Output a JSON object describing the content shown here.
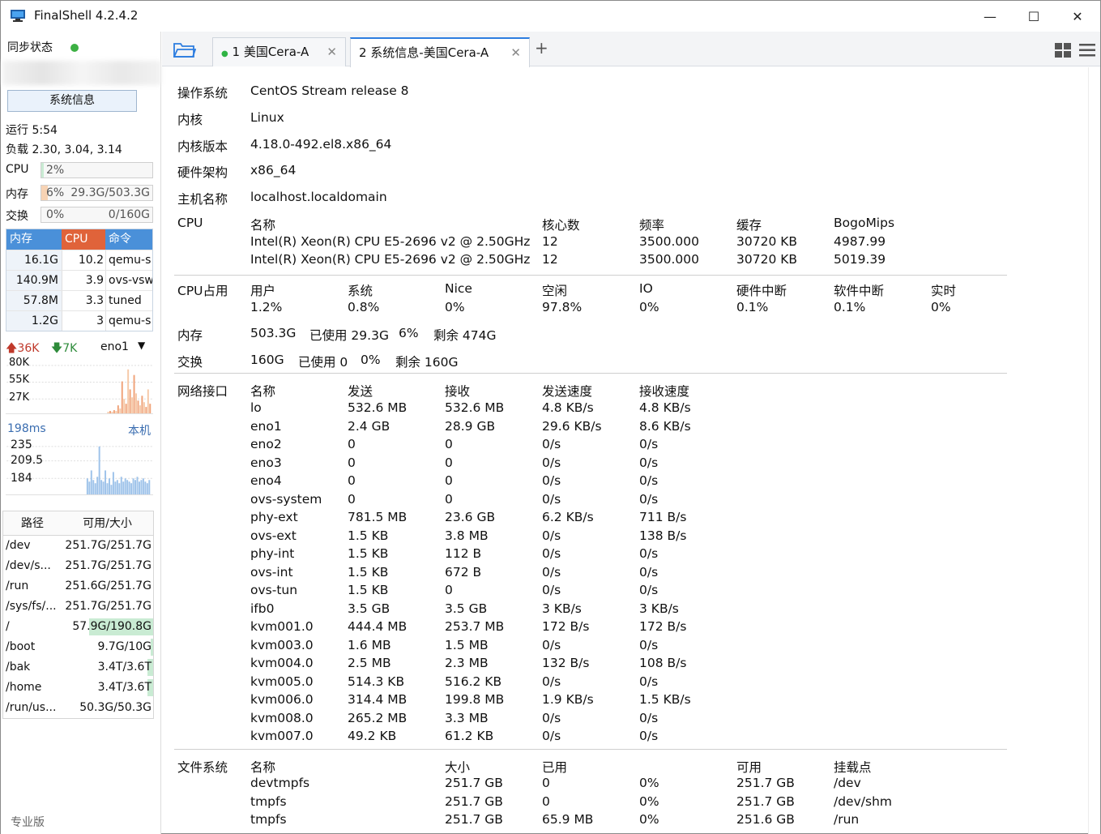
{
  "window": {
    "title": "FinalShell 4.2.4.2",
    "minimize": "—",
    "maximize": "☐",
    "close": "✕"
  },
  "sidebar": {
    "sync_label": "同步状态",
    "sysinfo_button": "系统信息",
    "uptime": "运行 5:54",
    "load": "负载 2.30, 3.04, 3.14",
    "cpu": {
      "label": "CPU",
      "text": "2%",
      "percent": 2
    },
    "mem": {
      "label": "内存",
      "left": "6%",
      "right": "29.3G/503.3G",
      "percent": 6
    },
    "swap": {
      "label": "交换",
      "left": "0%",
      "right": "0/160G",
      "percent": 0
    },
    "proc_headers": [
      "内存",
      "CPU",
      "命令"
    ],
    "processes": [
      {
        "mem": "16.1G",
        "cpu": "10.2",
        "cmd": "qemu-s"
      },
      {
        "mem": "140.9M",
        "cpu": "3.9",
        "cmd": "ovs-vsw"
      },
      {
        "mem": "57.8M",
        "cpu": "3.3",
        "cmd": "tuned"
      },
      {
        "mem": "1.2G",
        "cpu": "3",
        "cmd": "qemu-s"
      }
    ],
    "net": {
      "up": "36K",
      "down": "7K",
      "iface": "eno1",
      "ticks": [
        "80K",
        "55K",
        "27K"
      ]
    },
    "ping": {
      "latency": "198ms",
      "host": "本机",
      "ticks": [
        "235",
        "209.5",
        "184"
      ]
    },
    "disk_headers": [
      "路径",
      "可用/大小"
    ],
    "disks": [
      {
        "path": "/dev",
        "size": "251.7G/251.7G",
        "used": 0
      },
      {
        "path": "/dev/s...",
        "size": "251.7G/251.7G",
        "used": 0
      },
      {
        "path": "/run",
        "size": "251.6G/251.7G",
        "used": 0
      },
      {
        "path": "/sys/fs/...",
        "size": "251.7G/251.7G",
        "used": 0
      },
      {
        "path": "/",
        "size": "57.9G/190.8G",
        "used": 70
      },
      {
        "path": "/boot",
        "size": "9.7G/10G",
        "used": 3
      },
      {
        "path": "/bak",
        "size": "3.4T/3.6T",
        "used": 6
      },
      {
        "path": "/home",
        "size": "3.4T/3.6T",
        "used": 6
      },
      {
        "path": "/run/us...",
        "size": "50.3G/50.3G",
        "used": 0
      }
    ],
    "edition": "专业版"
  },
  "tabs": [
    {
      "label": "1 美国Cera-A",
      "active": false
    },
    {
      "label": "2 系统信息-美国Cera-A",
      "active": true
    }
  ],
  "info": {
    "os": {
      "label": "操作系统",
      "value": "CentOS Stream release 8"
    },
    "kernel": {
      "label": "内核",
      "value": "Linux"
    },
    "kernel_version": {
      "label": "内核版本",
      "value": "4.18.0-492.el8.x86_64"
    },
    "arch": {
      "label": "硬件架构",
      "value": "x86_64"
    },
    "hostname": {
      "label": "主机名称",
      "value": "localhost.localdomain"
    },
    "cpu_label": "CPU",
    "cpu_headers": [
      "名称",
      "核心数",
      "频率",
      "缓存",
      "BogoMips"
    ],
    "cpus": [
      [
        "Intel(R) Xeon(R) CPU E5-2696 v2 @ 2.50GHz",
        "12",
        "3500.000",
        "30720 KB",
        "4987.99"
      ],
      [
        "Intel(R) Xeon(R) CPU E5-2696 v2 @ 2.50GHz",
        "12",
        "3500.000",
        "30720 KB",
        "5019.39"
      ]
    ],
    "cpu_usage_label": "CPU占用",
    "cpu_usage_headers": [
      "用户",
      "系统",
      "Nice",
      "空闲",
      "IO",
      "硬件中断",
      "软件中断",
      "实时"
    ],
    "cpu_usage_values": [
      "1.2%",
      "0.8%",
      "0%",
      "97.8%",
      "0%",
      "0.1%",
      "0.1%",
      "0%"
    ],
    "memory": {
      "label": "内存",
      "total": "503.3G",
      "used": "已使用 29.3G",
      "pct": "6%",
      "free": "剩余 474G"
    },
    "swap": {
      "label": "交换",
      "total": "160G",
      "used": "已使用 0",
      "pct": "0%",
      "free": "剩余 160G"
    },
    "net_label": "网络接口",
    "net_headers": [
      "名称",
      "发送",
      "接收",
      "发送速度",
      "接收速度"
    ],
    "interfaces": [
      [
        "lo",
        "532.6 MB",
        "532.6 MB",
        "4.8 KB/s",
        "4.8 KB/s"
      ],
      [
        "eno1",
        "2.4 GB",
        "28.9 GB",
        "29.6 KB/s",
        "8.6 KB/s"
      ],
      [
        "eno2",
        "0",
        "0",
        "0/s",
        "0/s"
      ],
      [
        "eno3",
        "0",
        "0",
        "0/s",
        "0/s"
      ],
      [
        "eno4",
        "0",
        "0",
        "0/s",
        "0/s"
      ],
      [
        "ovs-system",
        "0",
        "0",
        "0/s",
        "0/s"
      ],
      [
        "phy-ext",
        "781.5 MB",
        "23.6 GB",
        "6.2 KB/s",
        "711 B/s"
      ],
      [
        "ovs-ext",
        "1.5 KB",
        "3.8 MB",
        "0/s",
        "138 B/s"
      ],
      [
        "phy-int",
        "1.5 KB",
        "112 B",
        "0/s",
        "0/s"
      ],
      [
        "ovs-int",
        "1.5 KB",
        "672 B",
        "0/s",
        "0/s"
      ],
      [
        "ovs-tun",
        "1.5 KB",
        "0",
        "0/s",
        "0/s"
      ],
      [
        "ifb0",
        "3.5 GB",
        "3.5 GB",
        "3 KB/s",
        "3 KB/s"
      ],
      [
        "kvm001.0",
        "444.4 MB",
        "253.7 MB",
        "172 B/s",
        "172 B/s"
      ],
      [
        "kvm003.0",
        "1.6 MB",
        "1.5 MB",
        "0/s",
        "0/s"
      ],
      [
        "kvm004.0",
        "2.5 MB",
        "2.3 MB",
        "132 B/s",
        "108 B/s"
      ],
      [
        "kvm005.0",
        "514.3 KB",
        "516.2 KB",
        "0/s",
        "0/s"
      ],
      [
        "kvm006.0",
        "314.4 MB",
        "199.8 MB",
        "1.9 KB/s",
        "1.5 KB/s"
      ],
      [
        "kvm008.0",
        "265.2 MB",
        "3.3 MB",
        "0/s",
        "0/s"
      ],
      [
        "kvm007.0",
        "49.2 KB",
        "61.2 KB",
        "0/s",
        "0/s"
      ]
    ],
    "fs_label": "文件系统",
    "fs_headers": [
      "名称",
      "大小",
      "已用",
      "可用",
      "挂载点"
    ],
    "filesystems": [
      [
        "devtmpfs",
        "251.7 GB",
        "0",
        "0%",
        "251.7 GB",
        "/dev"
      ],
      [
        "tmpfs",
        "251.7 GB",
        "0",
        "0%",
        "251.7 GB",
        "/dev/shm"
      ],
      [
        "tmpfs",
        "251.7 GB",
        "65.9 MB",
        "0%",
        "251.6 GB",
        "/run"
      ]
    ]
  },
  "colors": {
    "accent": "#2d7de0",
    "mem_head": "#4a90d9",
    "cpu_head": "#e0633a",
    "cmd_head": "#4a90d9",
    "net_up": "#c0392b",
    "net_down": "#2e8b3a",
    "ping": "#3a6db0"
  }
}
